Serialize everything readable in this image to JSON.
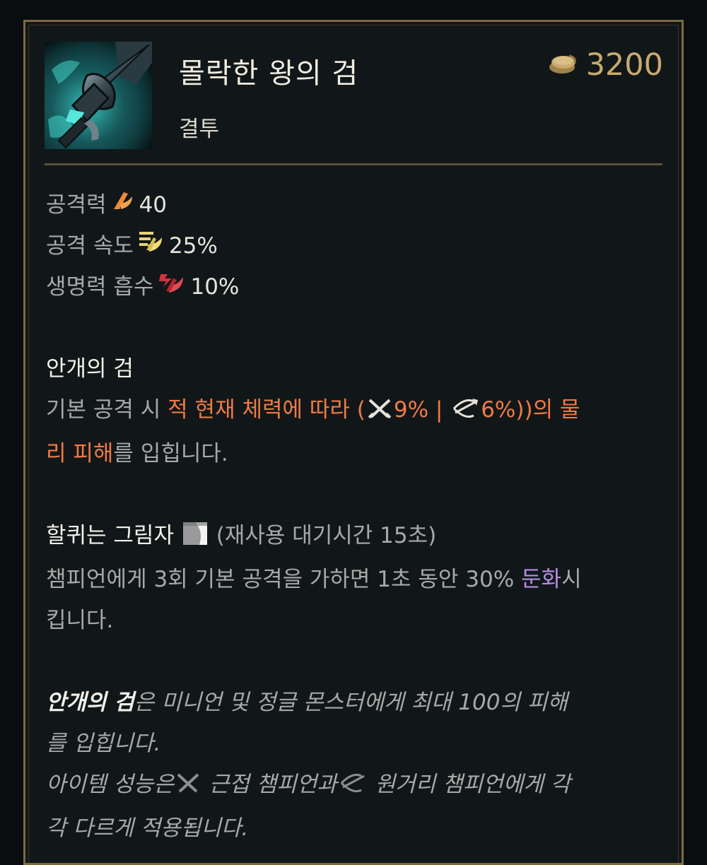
{
  "item": {
    "name": "몰락한 왕의 검",
    "tag": "결투",
    "price": "3200",
    "icon": "blade-of-the-ruined-king-icon"
  },
  "stats": [
    {
      "label": "공격력",
      "icon": "attack-damage-icon",
      "value": "40"
    },
    {
      "label": "공격 속도",
      "icon": "attack-speed-icon",
      "value": "25%"
    },
    {
      "label": "생명력 흡수",
      "icon": "life-steal-icon",
      "value": "10%"
    }
  ],
  "passive1": {
    "title": "안개의 검",
    "t1": "기본 공격 시 ",
    "t2": "적 현재 체력에 따라 (",
    "melee_val": "9%",
    "sep": " | ",
    "ranged_val": "6%",
    "t3": "))의 물",
    "t4": "리 피해",
    "t5": "를 입힙니다."
  },
  "passive2": {
    "title": "할퀴는 그림자",
    "cooldown": "(재사용 대기시간 15초)",
    "t1": "챔피언에게 3회 기본 공격을 가하면 1초 동안 30% ",
    "slow": "둔화",
    "t2": "시",
    "t3": "킵니다."
  },
  "notes": {
    "n1_bold": "안개의 검",
    "n1_rest": "은 미니언 및 정글 몬스터에게 최대 100의 피해",
    "n1_wrap": "를 입힙니다.",
    "n2_a": "아이템 성능은",
    "n2_b": " 근접 챔피언과",
    "n2_c": " 원거리 챔피언에게 각",
    "n2_wrap": "각 다르게 적용됩니다."
  },
  "colors": {
    "gold": "#c8aa6e",
    "orange": "#ef7b45",
    "purple": "#b58de8",
    "border": "#7a6a44"
  }
}
